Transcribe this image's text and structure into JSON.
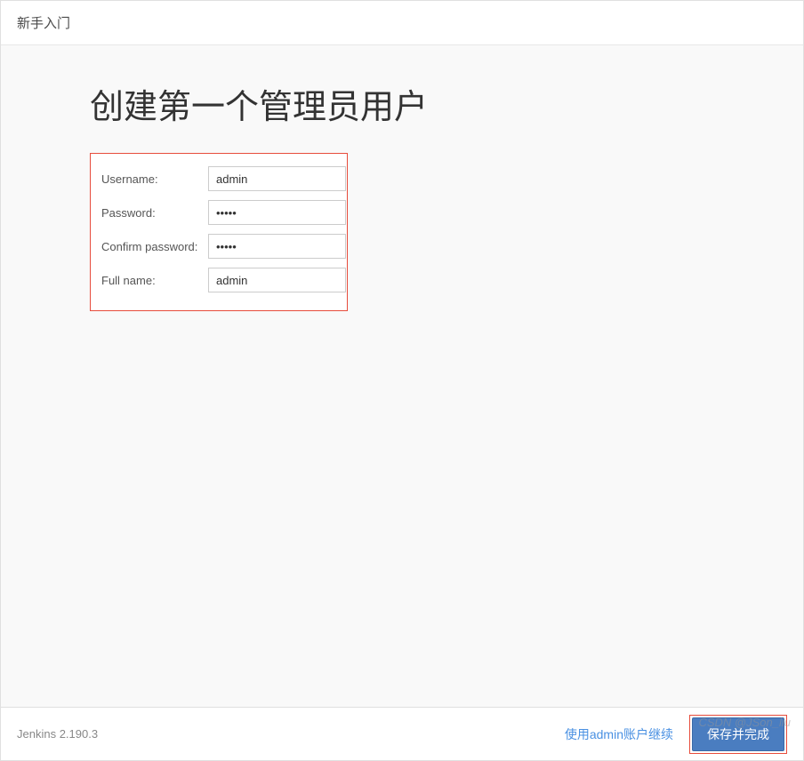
{
  "header": {
    "title": "新手入门"
  },
  "main": {
    "title": "创建第一个管理员用户"
  },
  "form": {
    "username": {
      "label": "Username:",
      "value": "admin"
    },
    "password": {
      "label": "Password:",
      "value": "•••••"
    },
    "confirm_password": {
      "label": "Confirm password:",
      "value": "•••••"
    },
    "fullname": {
      "label": "Full name:",
      "value": "admin"
    }
  },
  "footer": {
    "version": "Jenkins 2.190.3",
    "continue_link": "使用admin账户继续",
    "save_button": "保存并完成"
  },
  "watermark": "CSDN @JSon_liu"
}
